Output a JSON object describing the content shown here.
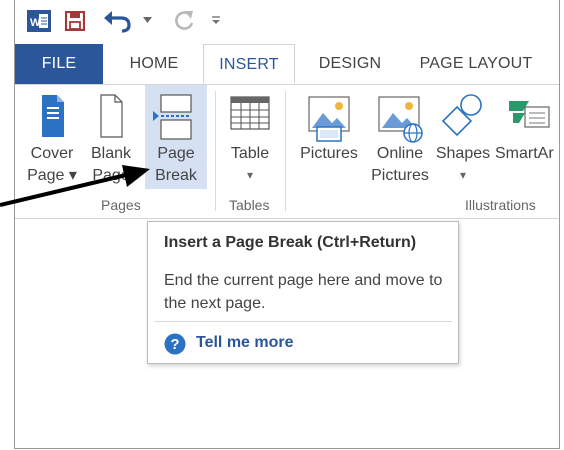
{
  "app": {
    "icon": "word-icon",
    "quick_access": [
      "save-icon",
      "undo-icon",
      "redo-icon",
      "customize-icon"
    ]
  },
  "tabs": [
    {
      "label": "FILE"
    },
    {
      "label": "HOME"
    },
    {
      "label": "INSERT"
    },
    {
      "label": "DESIGN"
    },
    {
      "label": "PAGE LAYOUT"
    }
  ],
  "active_tab": "INSERT",
  "ribbon": {
    "pages": {
      "label": "Pages",
      "cover": {
        "line1": "Cover",
        "line2": "Page ▾"
      },
      "blank": {
        "line1": "Blank",
        "line2": "Page"
      },
      "break": {
        "line1": "Page",
        "line2": "Break"
      }
    },
    "tables": {
      "label": "Tables",
      "table": {
        "line1": "Table",
        "line2": "▾"
      }
    },
    "illustrations": {
      "label": "Illustrations",
      "pictures": {
        "line1": "Pictures"
      },
      "online": {
        "line1": "Online",
        "line2": "Pictures"
      },
      "shapes": {
        "line1": "Shapes",
        "line2": "▾"
      },
      "smartart": {
        "line1": "SmartAr"
      }
    }
  },
  "tooltip": {
    "title": "Insert a Page Break (Ctrl+Return)",
    "body": "End the current page here and move to the next page.",
    "link": "Tell me more"
  },
  "colors": {
    "word_blue": "#2b579a",
    "active_button": "#d5e1f2",
    "qat_accent": "#a4373a"
  }
}
